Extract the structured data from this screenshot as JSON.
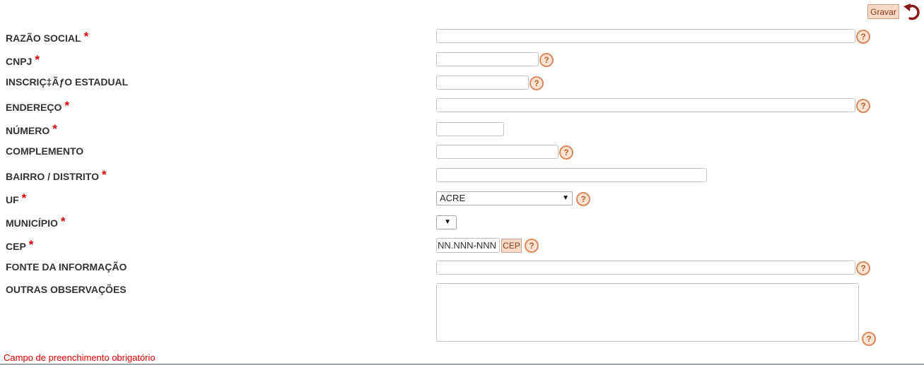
{
  "toolbar": {
    "save_label": "Gravar",
    "undo_icon": "undo-arrow-icon"
  },
  "required_marker": "*",
  "fields": {
    "razao_social": {
      "label": "RAZÃO SOCIAL",
      "value": ""
    },
    "cnpj": {
      "label": "CNPJ",
      "value": ""
    },
    "inscricao": {
      "label": "INSCRIÇ‡Ãƒ​O ESTADUAL",
      "value": ""
    },
    "endereco": {
      "label": "ENDEREÇO",
      "value": ""
    },
    "numero": {
      "label": "NÚMERO",
      "value": ""
    },
    "complemento": {
      "label": "COMPLEMENTO",
      "value": ""
    },
    "bairro": {
      "label": "BAIRRO / DISTRITO",
      "value": ""
    },
    "uf": {
      "label": "UF",
      "selected": "ACRE"
    },
    "municipio": {
      "label": "MUNICÍPIO",
      "selected": ""
    },
    "cep": {
      "label": "CEP",
      "placeholder": "NN.NNN-NNN",
      "button_label": "CEP"
    },
    "fonte": {
      "label": "FONTE DA INFORMAÇÃO",
      "value": ""
    },
    "observacoes": {
      "label": "OUTRAS OBSERVAÇÕES",
      "value": ""
    }
  },
  "help_glyph": "?",
  "dropdown_glyph": "▼",
  "footer_note": "Campo de preenchimento obrigatório",
  "colors": {
    "required": "#e00000",
    "button_bg": "#f7d9c6",
    "help_icon": "#d98a5e",
    "undo_icon": "#8b1a1a"
  }
}
